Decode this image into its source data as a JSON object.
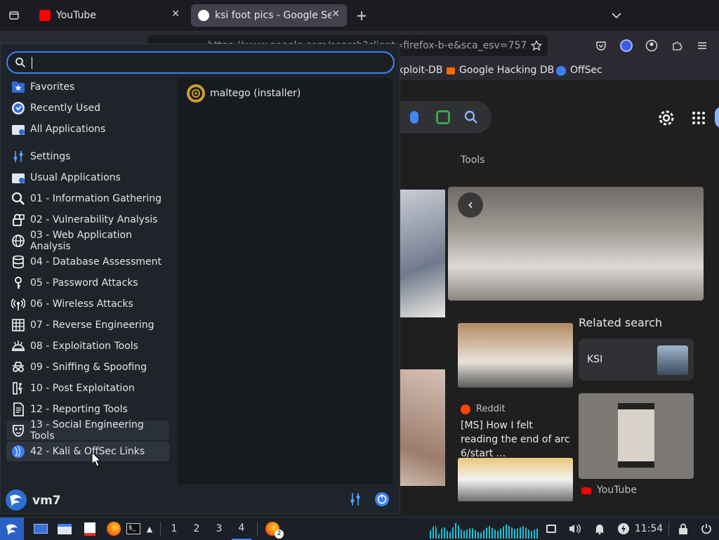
{
  "browser": {
    "tabs": [
      {
        "title": "YouTube",
        "favicon_color": "#ff0000",
        "active": false
      },
      {
        "title": "ksi foot pics - Google Sea",
        "favicon_color": "#4285f4",
        "active": true
      }
    ],
    "url": "https://www.google.com/search?client=firefox-b-e&sca_esv=757",
    "bookmarks": [
      "xploit-DB",
      "Google Hacking DB",
      "OffSec"
    ]
  },
  "google": {
    "tools_label": "Tools",
    "related_heading": "Related search",
    "related_chip": "KSI",
    "result1_source": "Reddit",
    "result1_title": "[MS] How I felt reading the end of arc 6/start ...",
    "result2_source": "YouTube"
  },
  "menu": {
    "search_value": "",
    "categories": [
      {
        "label": "Favorites",
        "icon": "star-folder-icon"
      },
      {
        "label": "Recently Used",
        "icon": "clock-icon"
      },
      {
        "label": "All Applications",
        "icon": "folder-icon"
      },
      {
        "label": "Settings",
        "icon": "settings-sliders-icon"
      },
      {
        "label": "Usual Applications",
        "icon": "folder-icon"
      },
      {
        "label": "01 - Information Gathering",
        "icon": "magnifier-icon"
      },
      {
        "label": "02 - Vulnerability Analysis",
        "icon": "lock-icon"
      },
      {
        "label": "03 - Web Application Analysis",
        "icon": "globe-icon"
      },
      {
        "label": "04 - Database Assessment",
        "icon": "database-icon"
      },
      {
        "label": "05 - Password Attacks",
        "icon": "key-icon"
      },
      {
        "label": "06 - Wireless Attacks",
        "icon": "wireless-icon"
      },
      {
        "label": "07 - Reverse Engineering",
        "icon": "grid-icon"
      },
      {
        "label": "08 - Exploitation Tools",
        "icon": "bomb-icon"
      },
      {
        "label": "09 - Sniffing & Spoofing",
        "icon": "spy-icon"
      },
      {
        "label": "10 - Post Exploitation",
        "icon": "runner-icon"
      },
      {
        "label": "12 - Reporting Tools",
        "icon": "document-icon"
      },
      {
        "label": "13 - Social Engineering Tools",
        "icon": "mask-icon"
      },
      {
        "label": "42 - Kali & OffSec Links",
        "icon": "kali-dragon-icon"
      }
    ],
    "apps": [
      {
        "label": "maltego (installer)",
        "icon": "maltego-icon"
      }
    ],
    "user": "vm7"
  },
  "taskbar": {
    "workspaces": [
      "1",
      "2",
      "3",
      "4"
    ],
    "active_workspace": "4",
    "badge": "2",
    "clock": "11:54"
  },
  "colors": {
    "accent": "#3d80f5",
    "menu_bg": "#1f242b"
  }
}
